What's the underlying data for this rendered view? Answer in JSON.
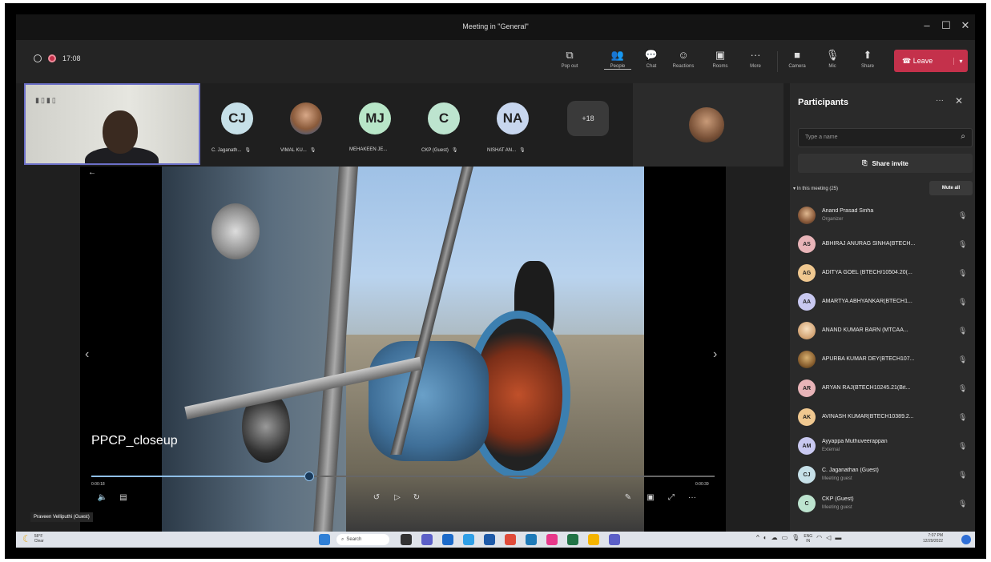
{
  "window": {
    "title": "Meeting in \"General\"",
    "controls": [
      "–",
      "☐",
      "✕"
    ]
  },
  "toolbar": {
    "timer": "17:08",
    "buttons": [
      {
        "label": "Pop out",
        "icon": "pop-out-icon",
        "glyph": "⧉"
      },
      {
        "label": "People",
        "icon": "people-icon",
        "glyph": "👥",
        "active": true
      },
      {
        "label": "Chat",
        "icon": "chat-icon",
        "glyph": "💬"
      },
      {
        "label": "Reactions",
        "icon": "reactions-icon",
        "glyph": "☺"
      },
      {
        "label": "Rooms",
        "icon": "rooms-icon",
        "glyph": "▣"
      },
      {
        "label": "More",
        "icon": "more-icon",
        "glyph": "···"
      },
      {
        "label": "Camera",
        "icon": "camera-icon",
        "glyph": "■"
      },
      {
        "label": "Mic",
        "icon": "mic-off-icon",
        "glyph": "🎙"
      },
      {
        "label": "Share",
        "icon": "share-icon",
        "glyph": "⬆"
      }
    ],
    "leave": "Leave",
    "leave_color": "#c4314b"
  },
  "strip": {
    "participants": [
      {
        "initials": "CJ",
        "name": "C. Jaganath...",
        "color": "#c6e0e8"
      },
      {
        "initials": "",
        "name": "VIMAL KU...",
        "color": "#c89a78"
      },
      {
        "initials": "MJ",
        "name": "MEHAKEEN JE...",
        "color": "#b8e6c8"
      },
      {
        "initials": "C",
        "name": "CKP (Guest)",
        "color": "#bde4cf"
      },
      {
        "initials": "NA",
        "name": "NISHAT AN...",
        "color": "#c7d6ee"
      }
    ],
    "more_count": "+18"
  },
  "video": {
    "title": "PPCP_closeup",
    "time_current": "0:00:18",
    "time_duration": "0:00:39",
    "progress": 0.35,
    "presenter": "Praveen Velliputhi (Guest)"
  },
  "panel": {
    "title": "Participants",
    "search_placeholder": "Type a name",
    "share_invite": "Share invite",
    "section": "In this meeting (25)",
    "mute_all": "Mute all",
    "people": [
      {
        "initials": "",
        "name": "Anand Prasad Sinha",
        "sub": "Organizer",
        "color": "#c89a78"
      },
      {
        "initials": "AS",
        "name": "ABHIRAJ ANURAG SINHA(BTECH...",
        "sub": "",
        "color": "#e8b4b8"
      },
      {
        "initials": "AG",
        "name": "ADITYA GOEL (BTECH/10504.20(...",
        "sub": "",
        "color": "#f0c890"
      },
      {
        "initials": "AA",
        "name": "AMARTYA ABHYANKAR(BTECH1...",
        "sub": "",
        "color": "#c8c8f0"
      },
      {
        "initials": "",
        "name": "ANAND KUMAR BARN (MTCAA...",
        "sub": "",
        "color": "#f0d0a0"
      },
      {
        "initials": "",
        "name": "APURBA KUMAR DEY(BTECH107...",
        "sub": "",
        "color": "#b08850"
      },
      {
        "initials": "AR",
        "name": "ARYAN RAJ(BTECH10245.21(Bit...",
        "sub": "",
        "color": "#e8b4b8"
      },
      {
        "initials": "AK",
        "name": "AVINASH KUMAR(BTECH10389.2...",
        "sub": "",
        "color": "#f0c890"
      },
      {
        "initials": "AM",
        "name": "Ayyappa Muthuveerappan",
        "sub": "External",
        "color": "#c8c8f0"
      },
      {
        "initials": "CJ",
        "name": "C. Jaganathan (Guest)",
        "sub": "Meeting guest",
        "color": "#c6e0e8"
      },
      {
        "initials": "C",
        "name": "CKP (Guest)",
        "sub": "Meeting guest",
        "color": "#bde4cf"
      }
    ]
  },
  "taskbar": {
    "weather_temp": "58°F",
    "weather_cond": "Clear",
    "search": "Search",
    "lang": "ENG",
    "lang_sub": "IN",
    "time": "7:07 PM",
    "date": "12/29/2022"
  }
}
